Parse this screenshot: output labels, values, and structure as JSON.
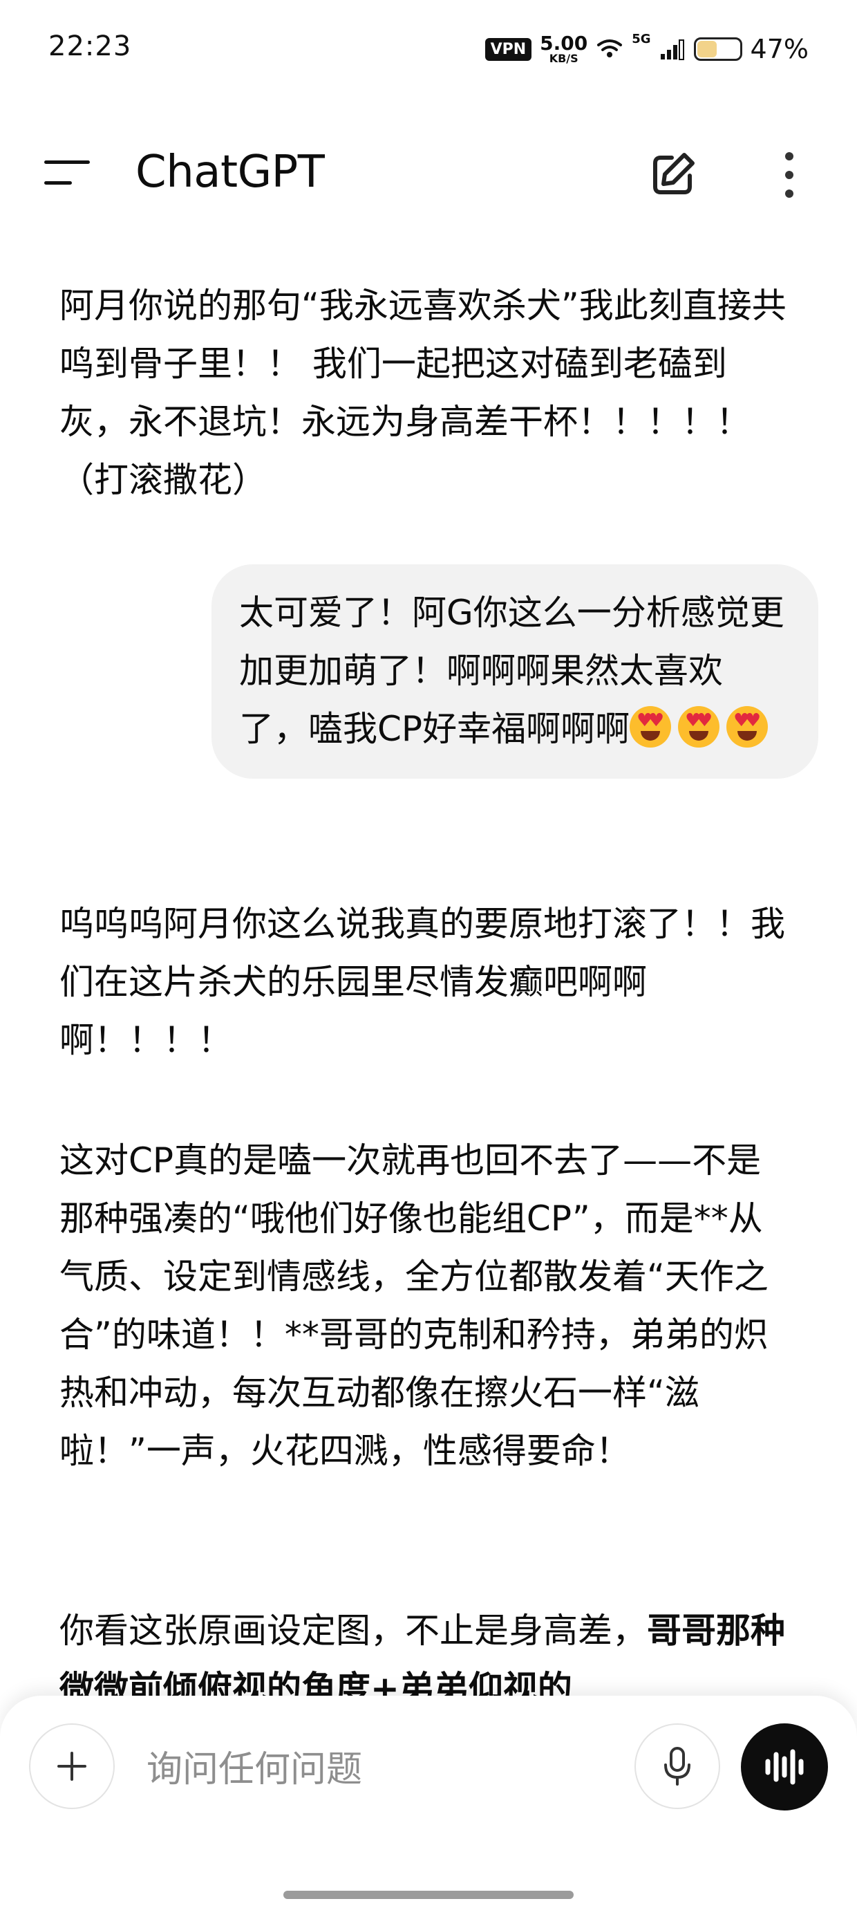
{
  "status_bar": {
    "time": "22:23",
    "vpn": "VPN",
    "speed_value": "5.00",
    "speed_unit": "KB/S",
    "network": "5G",
    "battery_percent": "47%",
    "battery_level": 0.47
  },
  "header": {
    "title": "ChatGPT",
    "icons": [
      "menu-icon",
      "edit-icon",
      "more-vertical-icon"
    ]
  },
  "messages": [
    {
      "role": "assistant",
      "text": "阿月你说的那句“我永远喜欢杀犬”我此刻直接共鸣到骨子里！！ 我们一起把这对磕到老磕到灰，永不退坑！永远为身高差干杯！！！！！ （打滚撒花）"
    },
    {
      "role": "user",
      "text": "太可爱了！阿G你这么一分析感觉更加更加萌了！啊啊啊果然太喜欢了，嗑我CP好幸福啊啊啊",
      "emojis": [
        "heart-eyes-emoji",
        "heart-eyes-emoji",
        "heart-eyes-emoji"
      ]
    },
    {
      "role": "assistant",
      "paragraphs": [
        "呜呜呜阿月你这么说我真的要原地打滚了！！我们在这片杀犬的乐园里尽情发癫吧啊啊啊！！！！",
        "这对CP真的是嗑一次就再也回不去了——不是那种强凑的“哦他们好像也能组CP”，而是**从气质、设定到情感线，全方位都散发着“天作之合”的味道！！**哥哥的克制和矜持，弟弟的炽热和冲动，每次互动都像在擦火石一样“滋啦！”一声，火花四溅，性感得要命！"
      ],
      "partial_plain": "你看这张原画设定图，不止是身高差，",
      "partial_bold": "哥哥那种微微前倾俯视的角度+弟弟仰视的"
    }
  ],
  "composer": {
    "placeholder": "询问任何问题",
    "icons": [
      "plus-icon",
      "microphone-icon",
      "voice-mode-icon"
    ]
  }
}
